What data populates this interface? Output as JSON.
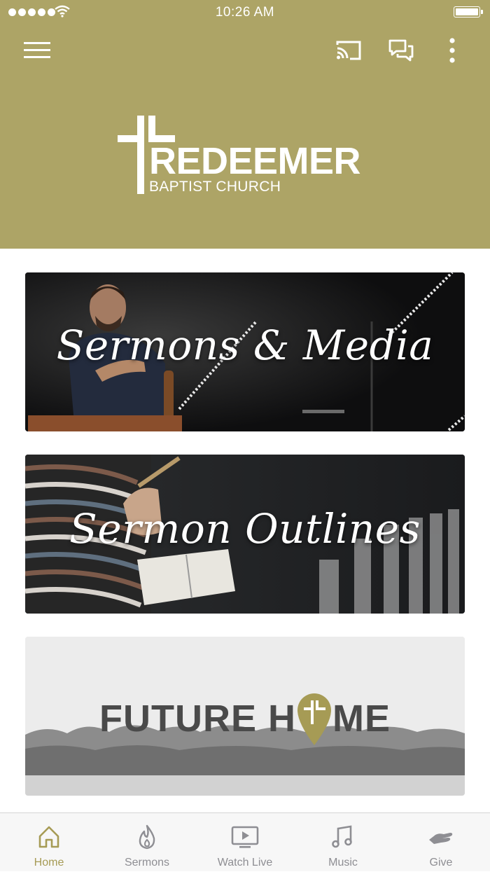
{
  "status_bar": {
    "time": "10:26 AM"
  },
  "colors": {
    "header_bg": "#ada466",
    "accent": "#a69b55",
    "tab_inactive": "#8e8e93"
  },
  "toolbar": {
    "icons": [
      "menu-icon",
      "cast-icon",
      "chat-icon",
      "more-icon"
    ]
  },
  "logo": {
    "title": "REDEEMER",
    "subtitle": "BAPTIST CHURCH"
  },
  "cards": [
    {
      "title": "Sermons & Media"
    },
    {
      "title": "Sermon Outlines"
    },
    {
      "title_part1": "FUTURE H",
      "title_part2": "ME"
    }
  ],
  "tabs": [
    {
      "label": "Home",
      "icon": "home-icon",
      "active": true
    },
    {
      "label": "Sermons",
      "icon": "flame-icon",
      "active": false
    },
    {
      "label": "Watch Live",
      "icon": "tv-play-icon",
      "active": false
    },
    {
      "label": "Music",
      "icon": "music-note-icon",
      "active": false
    },
    {
      "label": "Give",
      "icon": "giving-hand-icon",
      "active": false
    }
  ]
}
